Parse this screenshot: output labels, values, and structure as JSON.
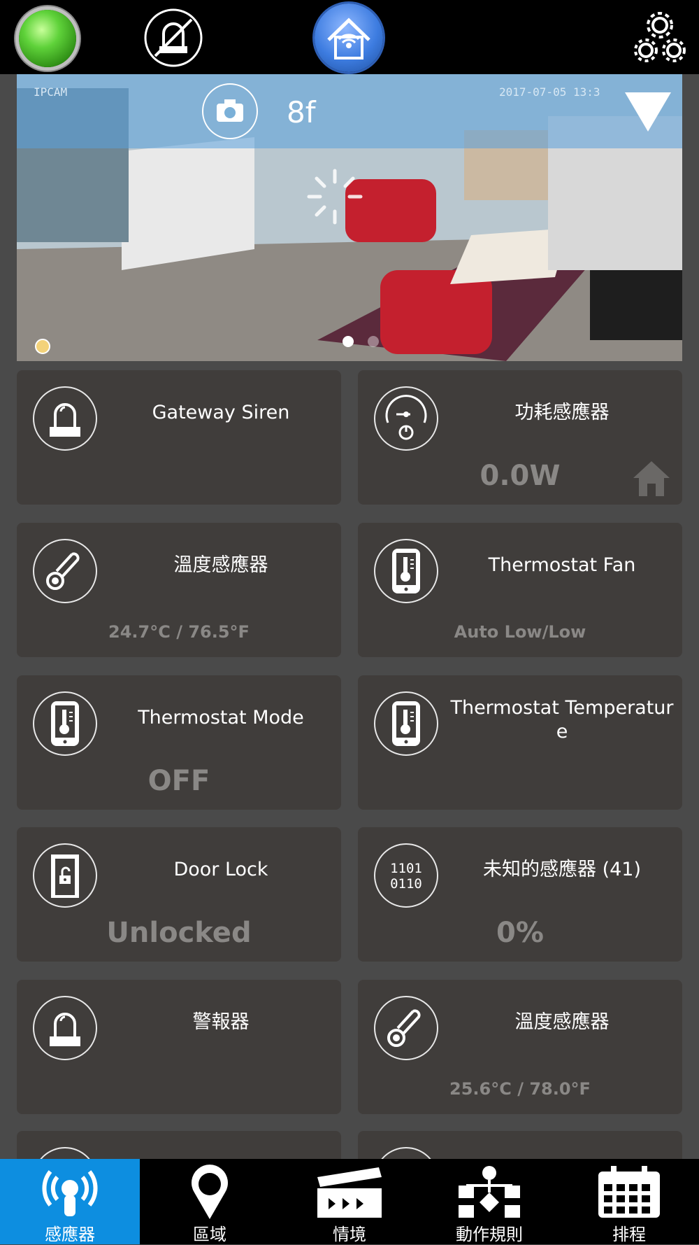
{
  "camera": {
    "label": "8f",
    "osd_left": "IPCAM",
    "osd_right": "2017-07-05 13:3"
  },
  "tiles": [
    {
      "name": "Gateway Siren",
      "value": "",
      "icon": "siren-icon"
    },
    {
      "name": "功耗感應器",
      "value": "0.0W",
      "icon": "power-meter-icon"
    },
    {
      "name": "溫度感應器",
      "value": "24.7°C / 76.5°F",
      "icon": "thermometer-icon"
    },
    {
      "name": "Thermostat Fan",
      "value": "Auto Low/Low",
      "icon": "thermostat-icon"
    },
    {
      "name": "Thermostat Mode",
      "value": "OFF",
      "icon": "thermostat-icon"
    },
    {
      "name": "Thermostat Temperature",
      "value": "",
      "icon": "thermostat-icon"
    },
    {
      "name": "Door Lock",
      "value": "Unlocked",
      "icon": "door-lock-icon"
    },
    {
      "name": "未知的感應器 (41)",
      "value": "0%",
      "icon": "binary-sensor-icon"
    },
    {
      "name": "警報器",
      "value": "",
      "icon": "siren-icon"
    },
    {
      "name": "溫度感應器",
      "value": "25.6°C / 78.0°F",
      "icon": "thermometer-icon"
    }
  ],
  "tabs": [
    {
      "label": "感應器",
      "icon": "sensor-icon",
      "active": true
    },
    {
      "label": "區域",
      "icon": "location-pin-icon",
      "active": false
    },
    {
      "label": "情境",
      "icon": "scene-clapper-icon",
      "active": false
    },
    {
      "label": "動作規則",
      "icon": "rules-icon",
      "active": false
    },
    {
      "label": "排程",
      "icon": "calendar-icon",
      "active": false
    }
  ],
  "colors": {
    "active_tab": "#0d8ee0",
    "tile_bg": "#403d3b",
    "background": "#4a4a4a",
    "status_green": "#5fd23a"
  }
}
